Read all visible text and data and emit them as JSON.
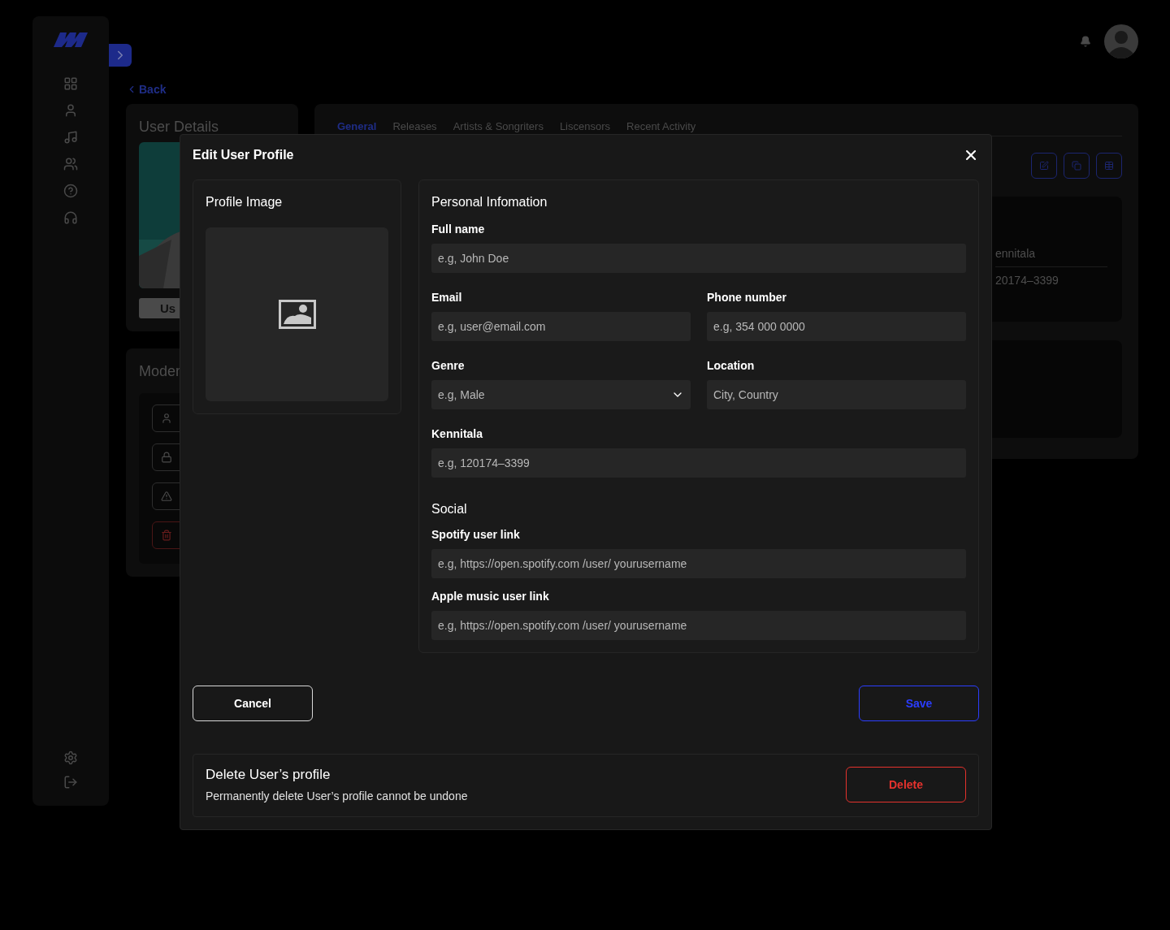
{
  "back": {
    "label": "Back"
  },
  "user_details": {
    "title": "User Details",
    "button": "Us"
  },
  "moderation": {
    "title": "Moder",
    "actions": [
      {
        "kind": "user"
      },
      {
        "kind": "lock"
      },
      {
        "kind": "warning"
      },
      {
        "kind": "delete"
      }
    ]
  },
  "tabs": [
    {
      "label": "General",
      "selected": true
    },
    {
      "label": "Releases",
      "selected": false
    },
    {
      "label": "Artists & Songriters",
      "selected": false
    },
    {
      "label": "Liscensors",
      "selected": false
    },
    {
      "label": "Recent Activity",
      "selected": false
    }
  ],
  "info_card": {
    "label": "ennitala",
    "value": "20174–3399"
  },
  "modal": {
    "title": "Edit User Profile",
    "image_section": {
      "title": "Profile Image"
    },
    "personal": {
      "title": "Personal Infomation",
      "rows": [
        [
          {
            "label": "Full name",
            "placeholder": "e.g, John Doe",
            "kind": "text"
          }
        ],
        [
          {
            "label": "Email",
            "placeholder": "e.g, user@email.com",
            "kind": "text"
          },
          {
            "label": "Phone number",
            "placeholder": "e.g, 354 000 0000",
            "kind": "text"
          }
        ],
        [
          {
            "label": "Genre",
            "placeholder": "e.g, Male",
            "kind": "select"
          },
          {
            "label": "Location",
            "placeholder": "City, Country",
            "kind": "text"
          }
        ],
        [
          {
            "label": "Kennitala",
            "placeholder": "e.g, 120174–3399",
            "kind": "text"
          }
        ]
      ]
    },
    "social": {
      "title": "Social",
      "fields": [
        {
          "label": "Spotify user link",
          "placeholder": "e.g, https://open.spotify.com /user/ yourusername",
          "kind": "text"
        },
        {
          "label": "Apple music user link",
          "placeholder": "e.g, https://open.spotify.com /user/ yourusername",
          "kind": "text"
        }
      ]
    },
    "cancel": "Cancel",
    "save": "Save",
    "danger": {
      "title": "Delete User’s profile",
      "description": "Permanently delete User’s profile cannot be undone",
      "button": "Delete"
    }
  }
}
